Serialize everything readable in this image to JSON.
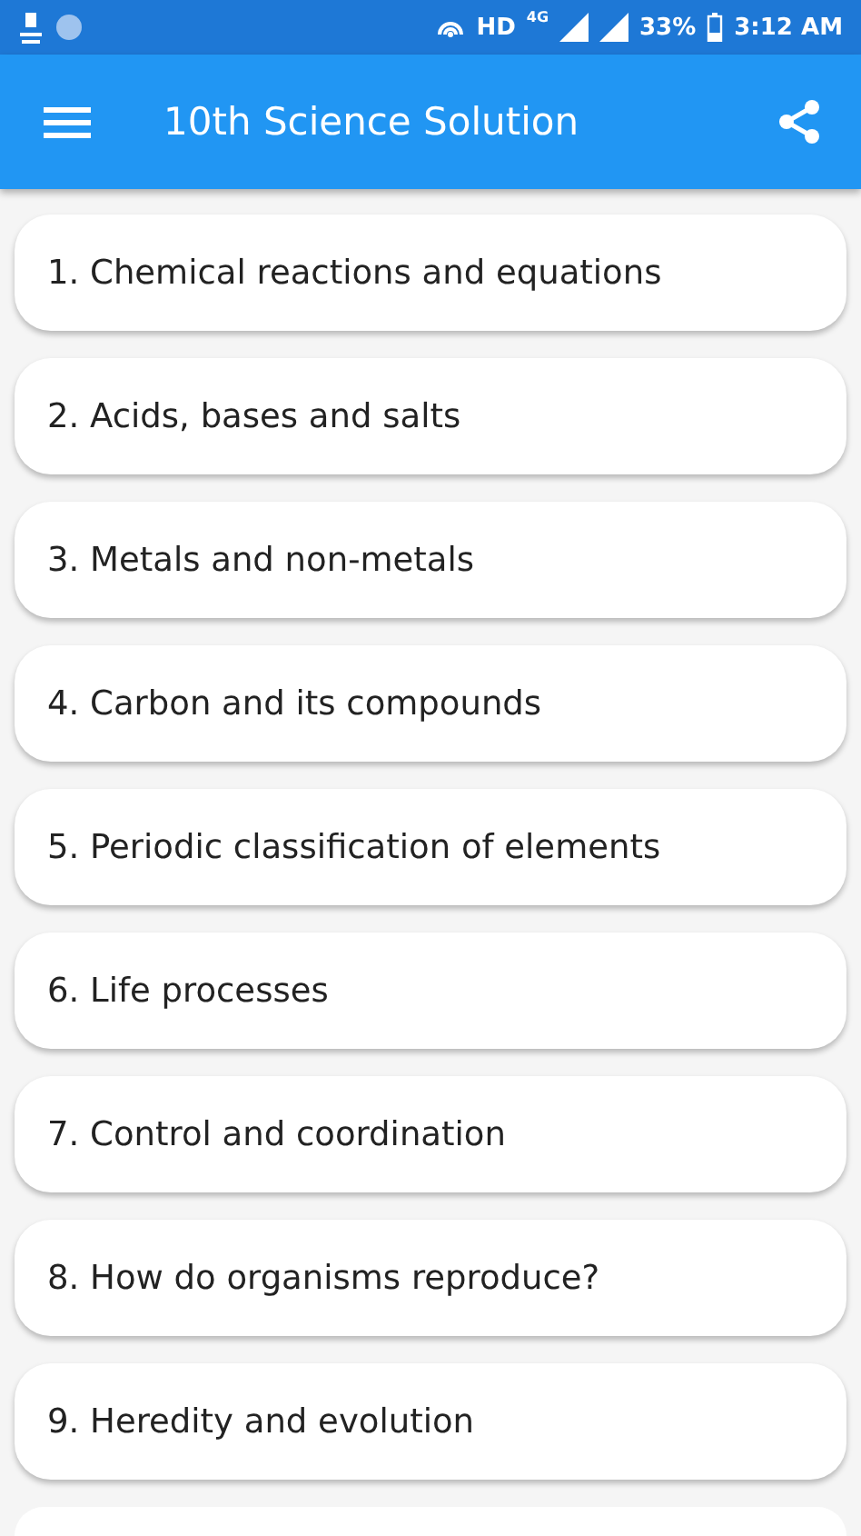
{
  "status_bar": {
    "network": "HD",
    "network_type": "4G",
    "battery": "33%",
    "time": "3:12 AM"
  },
  "app_bar": {
    "title": "10th Science Solution"
  },
  "chapters": [
    {
      "label": "1. Chemical reactions and equations"
    },
    {
      "label": "2. Acids, bases and salts"
    },
    {
      "label": "3. Metals and non-metals"
    },
    {
      "label": "4. Carbon and its compounds"
    },
    {
      "label": "5. Periodic classification of elements"
    },
    {
      "label": "6. Life processes"
    },
    {
      "label": "7. Control and coordination"
    },
    {
      "label": "8. How do organisms reproduce?"
    },
    {
      "label": "9. Heredity and evolution"
    }
  ],
  "more_below": true
}
